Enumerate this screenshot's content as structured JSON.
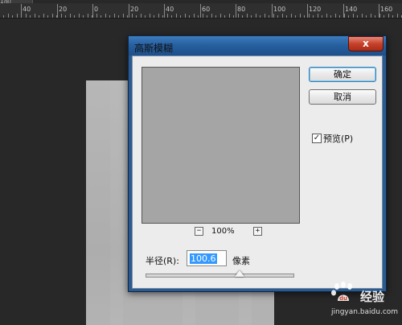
{
  "app": {
    "tab_stub_label": "1/8)"
  },
  "ruler": {
    "labels": [
      "40",
      "20",
      "0",
      "20",
      "40",
      "60",
      "80",
      "100",
      "120",
      "140",
      "160"
    ]
  },
  "dialog": {
    "title": "高斯模糊",
    "close_label": "x",
    "ok_label": "确定",
    "cancel_label": "取消",
    "preview_label": "预览(P)",
    "preview_checked": true,
    "zoom_out_label": "−",
    "zoom_level": "100%",
    "zoom_in_label": "+",
    "radius_label": "半径(R):",
    "radius_value": "100.6",
    "unit_label": "像素",
    "slider_level": 0.64
  },
  "colors": {
    "workspace_bg": "#282828",
    "titlebar": "#27609f",
    "close_button": "#c6412b",
    "selection": "#3399ff",
    "preview_fill": "#a5a5a5"
  },
  "watermark": {
    "text": "经验",
    "url": "jingyan.baidu.com"
  }
}
